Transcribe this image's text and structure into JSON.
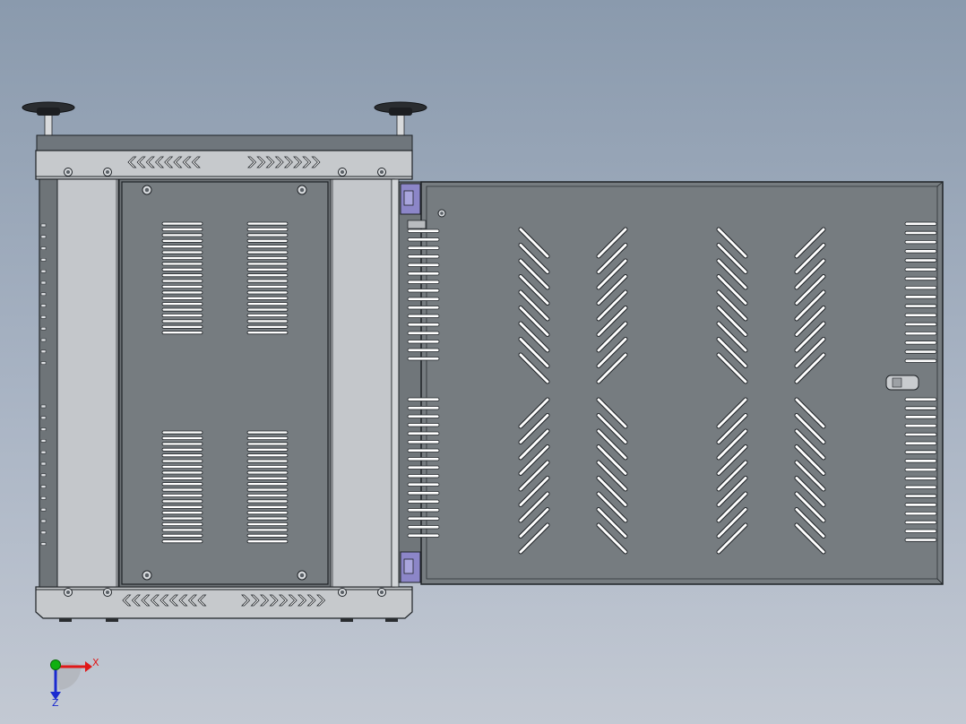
{
  "colors": {
    "background_top": "#8a9aad",
    "background_bottom": "#c3c9d3",
    "sheet_metal": "#767c80",
    "rail": "#c4c7cb",
    "edge": "#1e2226",
    "slot": "#ffffff",
    "hinge": "#8c86c8",
    "axis_x": "#e01818",
    "axis_y": "#10b010",
    "axis_z": "#1a2ad0"
  },
  "icons": {
    "triad": "coordinate-triad-icon",
    "handle": "knob-handle-icon",
    "screw": "screw-icon",
    "vent": "vent-slot-icon",
    "hinge": "hinge-icon",
    "latch": "latch-icon"
  },
  "triad": {
    "x_label": "X",
    "z_label": "Z"
  }
}
